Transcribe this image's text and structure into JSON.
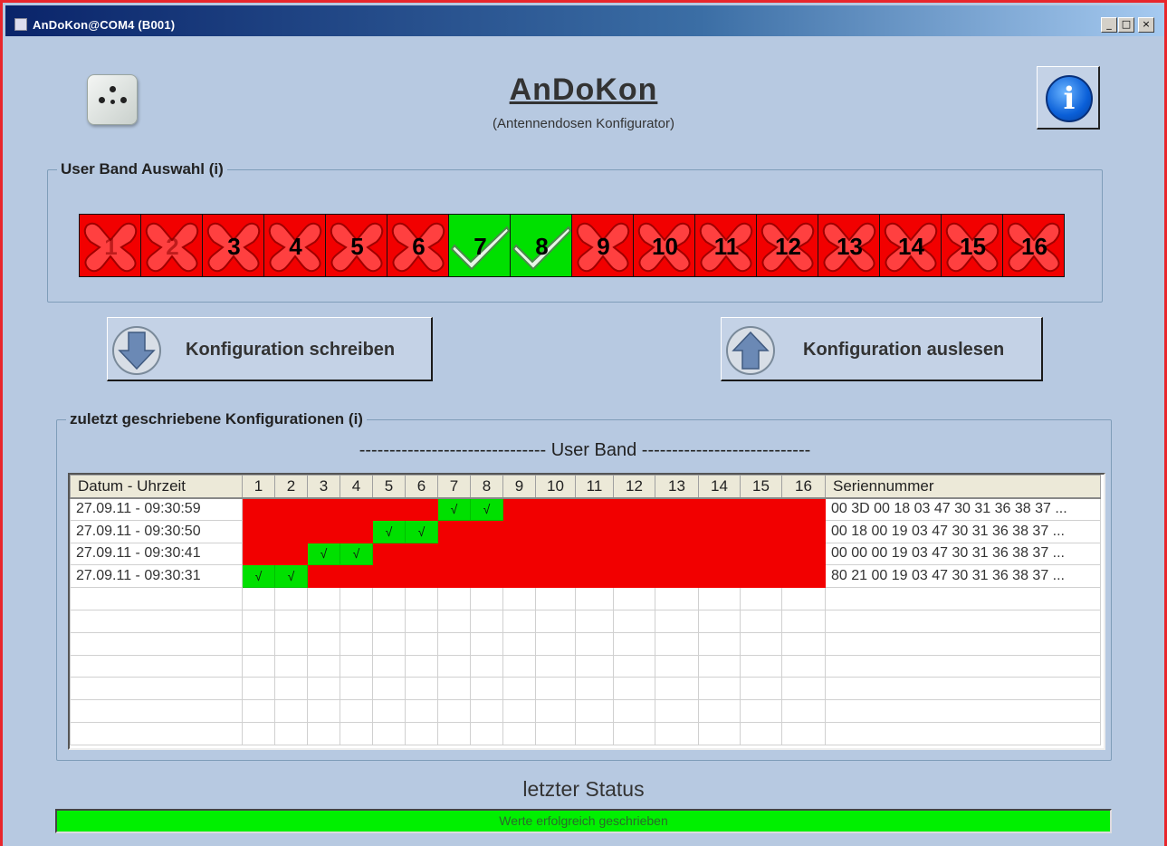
{
  "window": {
    "title": "AnDoKon@COM4 (B001)",
    "min_label": "_",
    "max_label": "□",
    "close_label": "×"
  },
  "header": {
    "title": "AnDoKon",
    "subtitle": "(Antennendosen Konfigurator)",
    "info_icon": "i"
  },
  "user_band_selection": {
    "legend": "User Band Auswahl (i)",
    "bands": [
      {
        "label": "1",
        "enabled": false,
        "dim": true
      },
      {
        "label": "2",
        "enabled": false,
        "dim": true
      },
      {
        "label": "3",
        "enabled": false,
        "dim": false
      },
      {
        "label": "4",
        "enabled": false,
        "dim": false
      },
      {
        "label": "5",
        "enabled": false,
        "dim": false
      },
      {
        "label": "6",
        "enabled": false,
        "dim": false
      },
      {
        "label": "7",
        "enabled": true,
        "dim": false
      },
      {
        "label": "8",
        "enabled": true,
        "dim": false
      },
      {
        "label": "9",
        "enabled": false,
        "dim": false
      },
      {
        "label": "10",
        "enabled": false,
        "dim": false
      },
      {
        "label": "11",
        "enabled": false,
        "dim": false
      },
      {
        "label": "12",
        "enabled": false,
        "dim": false
      },
      {
        "label": "13",
        "enabled": false,
        "dim": false
      },
      {
        "label": "14",
        "enabled": false,
        "dim": false
      },
      {
        "label": "15",
        "enabled": false,
        "dim": false
      },
      {
        "label": "16",
        "enabled": false,
        "dim": false
      }
    ]
  },
  "actions": {
    "write_label": "Konfiguration schreiben",
    "read_label": "Konfiguration auslesen"
  },
  "history": {
    "legend": "zuletzt geschriebene Konfigurationen (i)",
    "band_heading_left": "-------------------------------",
    "band_heading_mid": "User Band",
    "band_heading_right": "----------------------------",
    "columns": [
      "Datum - Uhrzeit",
      "1",
      "2",
      "3",
      "4",
      "5",
      "6",
      "7",
      "8",
      "9",
      "10",
      "11",
      "12",
      "13",
      "14",
      "15",
      "16",
      "Seriennummer"
    ],
    "check_glyph": "√",
    "rows": [
      {
        "datetime": "27.09.11 - 09:30:59",
        "bands": [
          0,
          0,
          0,
          0,
          0,
          0,
          1,
          1,
          0,
          0,
          0,
          0,
          0,
          0,
          0,
          0
        ],
        "serial": "00 3D 00 18 03 47 30 31 36 38 37 ..."
      },
      {
        "datetime": "27.09.11 - 09:30:50",
        "bands": [
          0,
          0,
          0,
          0,
          1,
          1,
          0,
          0,
          0,
          0,
          0,
          0,
          0,
          0,
          0,
          0
        ],
        "serial": "00 18 00 19 03 47 30 31 36 38 37 ..."
      },
      {
        "datetime": "27.09.11 - 09:30:41",
        "bands": [
          0,
          0,
          1,
          1,
          0,
          0,
          0,
          0,
          0,
          0,
          0,
          0,
          0,
          0,
          0,
          0
        ],
        "serial": "00 00 00 19 03 47 30 31 36 38 37 ..."
      },
      {
        "datetime": "27.09.11 - 09:30:31",
        "bands": [
          1,
          1,
          0,
          0,
          0,
          0,
          0,
          0,
          0,
          0,
          0,
          0,
          0,
          0,
          0,
          0
        ],
        "serial": "80 21 00 19 03 47 30 31 36 38 37 ..."
      }
    ],
    "empty_rows": 7
  },
  "status": {
    "label": "letzter Status",
    "message": "Werte erfolgreich geschrieben"
  },
  "colors": {
    "band_off": "#f20000",
    "band_on": "#00e000",
    "status_ok": "#00f000",
    "background": "#b7c9e1"
  }
}
